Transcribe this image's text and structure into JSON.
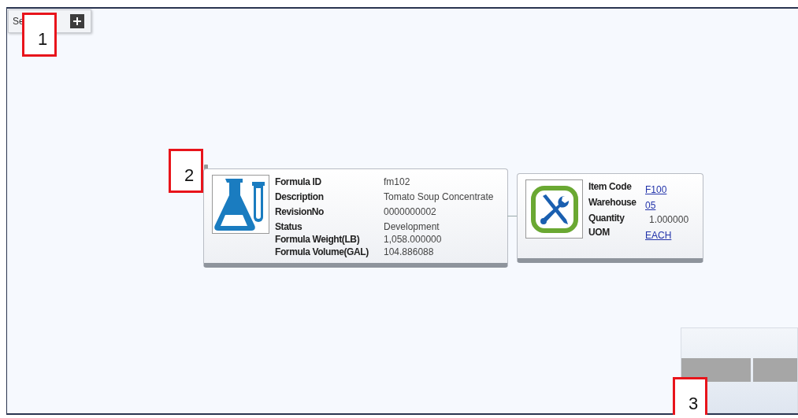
{
  "toolbar": {
    "label": "Se"
  },
  "formula_node": {
    "fields": [
      {
        "label": "Formula ID",
        "value": "fm102"
      },
      {
        "label": "Description",
        "value": "Tomato Soup Concentrate"
      },
      {
        "label": "RevisionNo",
        "value": "0000000002"
      },
      {
        "label": "Status",
        "value": "Development"
      },
      {
        "label": "Formula Weight(LB)",
        "value": "1,058.000000"
      },
      {
        "label": "Formula Volume(GAL)",
        "value": "104.886088"
      }
    ]
  },
  "item_node": {
    "fields": [
      {
        "label": "Item Code",
        "value": "F100",
        "kind": "link"
      },
      {
        "label": "Warehouse",
        "value": "05",
        "kind": "link"
      },
      {
        "label": "Quantity",
        "value": "1.000000",
        "kind": "plain"
      },
      {
        "label": "UOM",
        "value": "EACH",
        "kind": "link"
      }
    ]
  },
  "callouts": [
    "1",
    "2",
    "3"
  ]
}
